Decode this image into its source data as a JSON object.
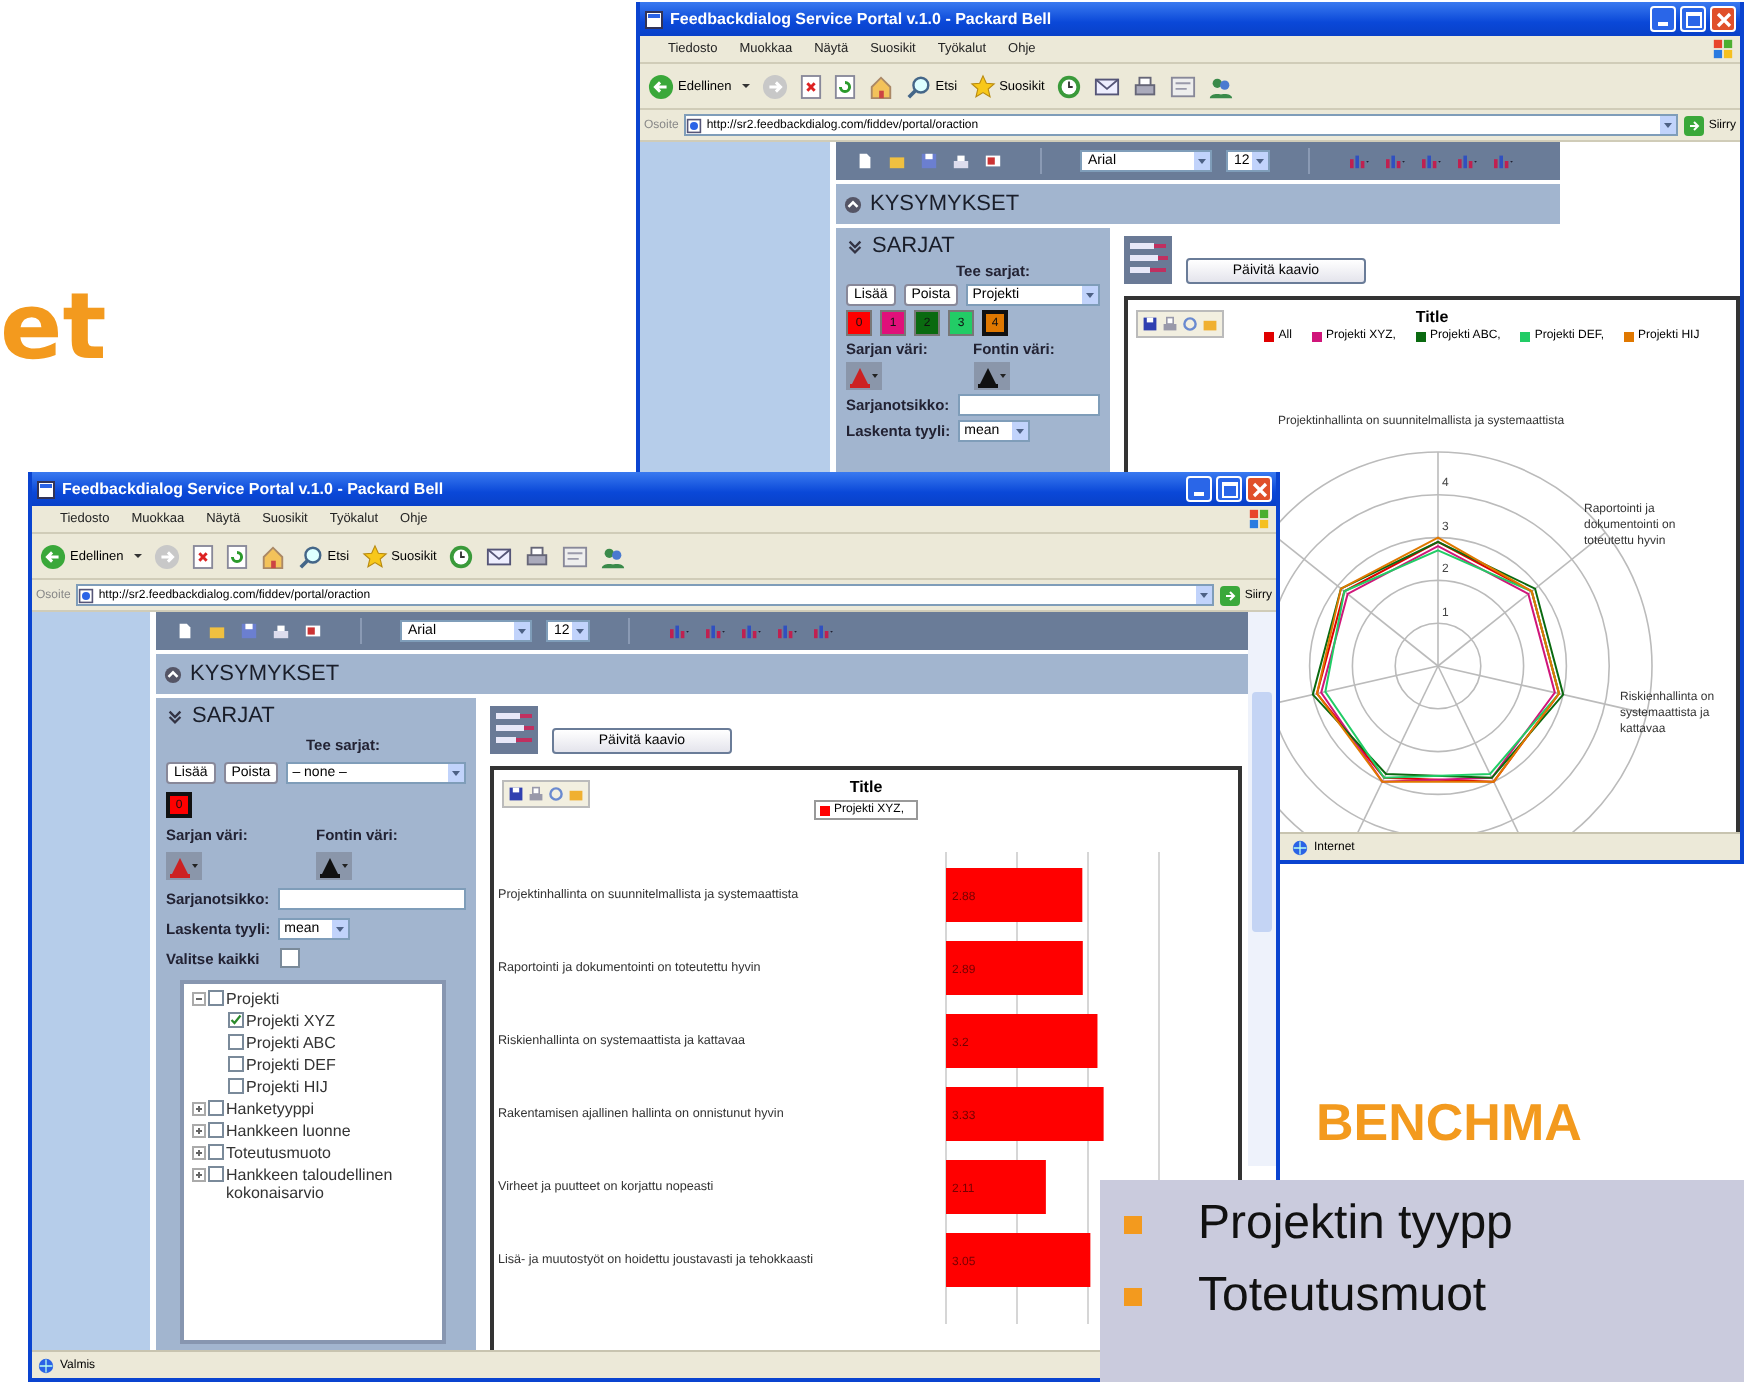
{
  "slide": {
    "title_fragment": "et",
    "section_heading": "BENCHMA",
    "bullets": [
      "Projektin tyypp",
      "Toteutusmuot"
    ]
  },
  "windows": [
    {
      "title": "Feedbackdialog Service Portal v.1.0 - Packard Bell",
      "menu": [
        "Tiedosto",
        "Muokkaa",
        "Näytä",
        "Suosikit",
        "Työkalut",
        "Ohje"
      ],
      "back_label": "Edellinen",
      "search_label": "Etsi",
      "favorites_label": "Suosikit",
      "address_label": "Osoite",
      "url": "http://sr2.feedbackdialog.com/fiddev/portal/oraction",
      "go_label": "Siirry",
      "font": "Arial",
      "font_size": "12",
      "questions_header": "KYSYMYKSET",
      "series_panel": {
        "header": "SARJAT",
        "make_series_label": "Tee sarjat:",
        "add_button": "Lisää",
        "remove_button": "Poista",
        "series_select": "Projekti",
        "chips": [
          {
            "label": "0",
            "color": "#ff0000",
            "selected": false
          },
          {
            "label": "1",
            "color": "#e0107a",
            "selected": false
          },
          {
            "label": "2",
            "color": "#0a6a10",
            "selected": false
          },
          {
            "label": "3",
            "color": "#22cc66",
            "selected": false
          },
          {
            "label": "4",
            "color": "#e07800",
            "selected": true
          }
        ],
        "series_color_label": "Sarjan väri:",
        "font_color_label": "Fontin väri:",
        "series_title_label": "Sarjanotsikko:",
        "calc_label": "Laskenta tyyli:",
        "calc_value": "mean"
      },
      "update_button": "Päivitä kaavio",
      "chart": {
        "kind": "radar",
        "title": "Title",
        "legend": [
          {
            "label": "All",
            "color": "#e00000"
          },
          {
            "label": "Projekti XYZ,",
            "color": "#d0157a"
          },
          {
            "label": "Projekti ABC,",
            "color": "#0a6a10"
          },
          {
            "label": "Projekti DEF,",
            "color": "#22cc66"
          },
          {
            "label": "Projekti HIJ",
            "color": "#e07800"
          }
        ],
        "tick_labels": [
          "4",
          "3",
          "2",
          "1"
        ],
        "axis_labels": [
          "Projektinhallinta on suunnitelmallista ja systemaattista",
          "Raportointi ja dokumentointi on toteutettu hyvin",
          "Riskienhallinta on systemaattista ja kattavaa"
        ]
      },
      "status": "Internet"
    },
    {
      "title": "Feedbackdialog Service Portal v.1.0 - Packard Bell",
      "menu": [
        "Tiedosto",
        "Muokkaa",
        "Näytä",
        "Suosikit",
        "Työkalut",
        "Ohje"
      ],
      "back_label": "Edellinen",
      "search_label": "Etsi",
      "favorites_label": "Suosikit",
      "address_label": "Osoite",
      "url": "http://sr2.feedbackdialog.com/fiddev/portal/oraction",
      "go_label": "Siirry",
      "font": "Arial",
      "font_size": "12",
      "questions_header": "KYSYMYKSET",
      "series_panel": {
        "header": "SARJAT",
        "make_series_label": "Tee sarjat:",
        "add_button": "Lisää",
        "remove_button": "Poista",
        "series_select": "– none –",
        "chips": [
          {
            "label": "0",
            "color": "#ff0000",
            "selected": true
          }
        ],
        "series_color_label": "Sarjan väri:",
        "font_color_label": "Fontin väri:",
        "series_title_label": "Sarjanotsikko:",
        "calc_label": "Laskenta tyyli:",
        "calc_value": "mean",
        "select_all_label": "Valitse kaikki",
        "select_all_checked": false,
        "tree": [
          {
            "label": "Projekti",
            "checked": false,
            "expanded": true,
            "children": [
              {
                "label": "Projekti XYZ",
                "checked": true
              },
              {
                "label": "Projekti ABC",
                "checked": false
              },
              {
                "label": "Projekti DEF",
                "checked": false
              },
              {
                "label": "Projekti HIJ",
                "checked": false
              }
            ]
          },
          {
            "label": "Hanketyyppi",
            "checked": false,
            "expanded": false
          },
          {
            "label": "Hankkeen luonne",
            "checked": false,
            "expanded": false
          },
          {
            "label": "Toteutusmuoto",
            "checked": false,
            "expanded": false
          },
          {
            "label": "Hankkeen taloudellinen kokonaisarvio",
            "checked": false,
            "expanded": false
          }
        ]
      },
      "update_button": "Päivitä kaavio",
      "chart": {
        "kind": "bar",
        "title": "Title",
        "chart_data": {
          "type": "bar",
          "orientation": "horizontal",
          "categories": [
            "Projektinhallinta on suunnitelmallista ja systemaattista",
            "Raportointi ja dokumentointi on toteutettu hyvin",
            "Riskienhallinta on systemaattista ja kattavaa",
            "Rakentamisen ajallinen hallinta on onnistunut hyvin",
            "Virheet ja puutteet on korjattu nopeasti",
            "Lisä- ja muutostyöt on hoidettu joustavasti ja tehokkaasti"
          ],
          "series": [
            {
              "name": "Projekti XYZ,",
              "color": "#ff0000",
              "values": [
                2.88,
                2.89,
                3.2,
                3.33,
                2.11,
                3.05
              ]
            }
          ],
          "data_labels": true,
          "value_labels": [
            "2.88",
            "2.89",
            "3.2",
            "3.33",
            "2.11",
            "3.05"
          ]
        }
      },
      "status": "Valmis"
    }
  ]
}
